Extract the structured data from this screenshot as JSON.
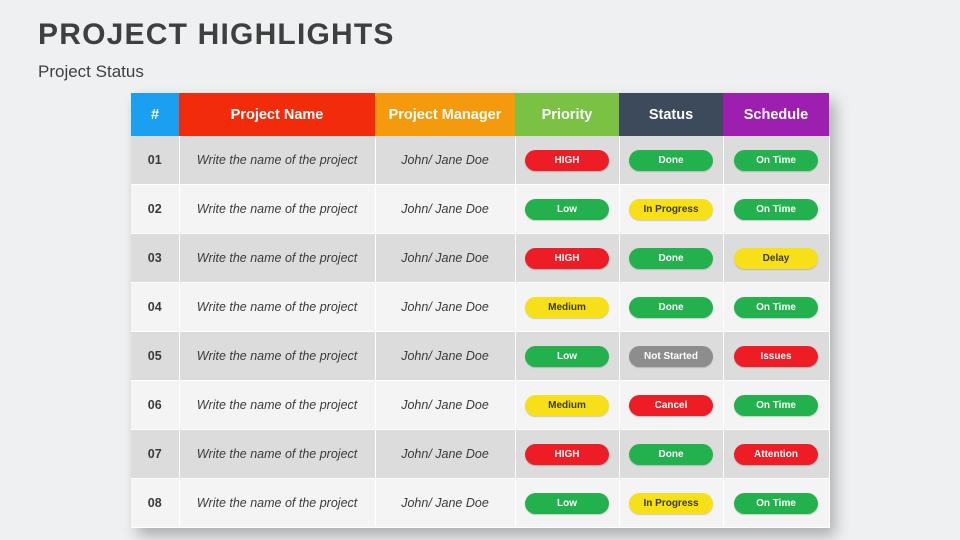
{
  "slide": {
    "title": "PROJECT HIGHLIGHTS",
    "subtitle": "Project Status"
  },
  "table": {
    "headers": [
      {
        "label": "#",
        "color": "#1b9ff0"
      },
      {
        "label": "Project Name",
        "color": "#f22c0a"
      },
      {
        "label": "Project Manager",
        "color": "#f59a0c"
      },
      {
        "label": "Priority",
        "color": "#7bc143"
      },
      {
        "label": "Status",
        "color": "#3d4a5c"
      },
      {
        "label": "Schedule",
        "color": "#9c1fb0"
      }
    ],
    "rows": [
      {
        "index": "01",
        "name": "Write the name of the project",
        "manager": "John/ Jane Doe",
        "priority": {
          "label": "HIGH",
          "color": "#ee1c25",
          "text_color": "#ffffff"
        },
        "status": {
          "label": "Done",
          "color": "#22b14c",
          "text_color": "#ffffff"
        },
        "schedule": {
          "label": "On Time",
          "color": "#22b14c",
          "text_color": "#ffffff"
        }
      },
      {
        "index": "02",
        "name": "Write the name of the project",
        "manager": "John/ Jane Doe",
        "priority": {
          "label": "Low",
          "color": "#22b14c",
          "text_color": "#ffffff"
        },
        "status": {
          "label": "In Progress",
          "color": "#f7e017",
          "text_color": "#3a3a00"
        },
        "schedule": {
          "label": "On Time",
          "color": "#22b14c",
          "text_color": "#ffffff"
        }
      },
      {
        "index": "03",
        "name": "Write the name of the project",
        "manager": "John/ Jane Doe",
        "priority": {
          "label": "HIGH",
          "color": "#ee1c25",
          "text_color": "#ffffff"
        },
        "status": {
          "label": "Done",
          "color": "#22b14c",
          "text_color": "#ffffff"
        },
        "schedule": {
          "label": "Delay",
          "color": "#f7e017",
          "text_color": "#3a3a00"
        }
      },
      {
        "index": "04",
        "name": "Write the name of the project",
        "manager": "John/ Jane Doe",
        "priority": {
          "label": "Medium",
          "color": "#f7e017",
          "text_color": "#3a3a00"
        },
        "status": {
          "label": "Done",
          "color": "#22b14c",
          "text_color": "#ffffff"
        },
        "schedule": {
          "label": "On Time",
          "color": "#22b14c",
          "text_color": "#ffffff"
        }
      },
      {
        "index": "05",
        "name": "Write the name of the project",
        "manager": "John/ Jane Doe",
        "priority": {
          "label": "Low",
          "color": "#22b14c",
          "text_color": "#ffffff"
        },
        "status": {
          "label": "Not Started",
          "color": "#8d8d8d",
          "text_color": "#ffffff"
        },
        "schedule": {
          "label": "Issues",
          "color": "#ee1c25",
          "text_color": "#ffffff"
        }
      },
      {
        "index": "06",
        "name": "Write the name of the project",
        "manager": "John/ Jane Doe",
        "priority": {
          "label": "Medium",
          "color": "#f7e017",
          "text_color": "#3a3a00"
        },
        "status": {
          "label": "Cancel",
          "color": "#ee1c25",
          "text_color": "#ffffff"
        },
        "schedule": {
          "label": "On Time",
          "color": "#22b14c",
          "text_color": "#ffffff"
        }
      },
      {
        "index": "07",
        "name": "Write the name of the project",
        "manager": "John/ Jane Doe",
        "priority": {
          "label": "HIGH",
          "color": "#ee1c25",
          "text_color": "#ffffff"
        },
        "status": {
          "label": "Done",
          "color": "#22b14c",
          "text_color": "#ffffff"
        },
        "schedule": {
          "label": "Attention",
          "color": "#ee1c25",
          "text_color": "#ffffff"
        }
      },
      {
        "index": "08",
        "name": "Write the name of the project",
        "manager": "John/ Jane Doe",
        "priority": {
          "label": "Low",
          "color": "#22b14c",
          "text_color": "#ffffff"
        },
        "status": {
          "label": "In Progress",
          "color": "#f7e017",
          "text_color": "#3a3a00"
        },
        "schedule": {
          "label": "On Time",
          "color": "#22b14c",
          "text_color": "#ffffff"
        }
      }
    ]
  }
}
